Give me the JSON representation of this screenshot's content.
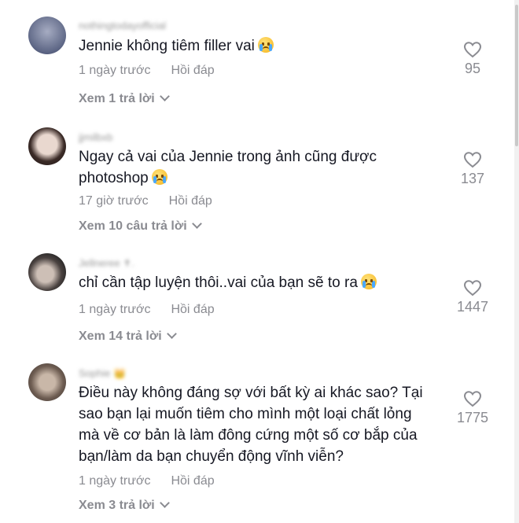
{
  "comments": [
    {
      "username": "nothingtodayofficial",
      "lines": [
        "Jennie không tiêm filler vai"
      ],
      "emoji": "loudly-crying-face",
      "time": "1 ngày trước",
      "reply_label": "Hồi đáp",
      "view_replies": "Xem 1 trả lời",
      "likes": "95"
    },
    {
      "username": "jjmilbxb",
      "lines": [
        "Ngay cả vai của Jennie trong ảnh cũng được",
        "photoshop"
      ],
      "emoji": "loudly-crying-face",
      "time": "17 giờ trước",
      "reply_label": "Hồi đáp",
      "view_replies": "Xem 10 câu trả lời",
      "likes": "137"
    },
    {
      "username": "Jellneree ✝.",
      "lines": [
        "chỉ cần tập luyện thôi..vai của bạn sẽ to ra"
      ],
      "emoji": "loudly-crying-face",
      "time": "1 ngày trước",
      "reply_label": "Hồi đáp",
      "view_replies": "Xem 14 trả lời",
      "likes": "1447"
    },
    {
      "username": "Sophie 👑",
      "lines": [
        "Điều này không đáng sợ với bất kỳ ai khác sao? Tại",
        "sao bạn lại muốn tiêm cho mình một loại chất lỏng",
        "mà về cơ bản là làm đông cứng một số cơ bắp của",
        "bạn/làm da bạn chuyển động vĩnh viễn?"
      ],
      "emoji": "",
      "time": "1 ngày trước",
      "reply_label": "Hồi đáp",
      "view_replies": "Xem 3 trả lời",
      "likes": "1775"
    }
  ],
  "colors": {
    "text": "#161823",
    "muted": "#8a8b91",
    "background": "#ffffff"
  }
}
